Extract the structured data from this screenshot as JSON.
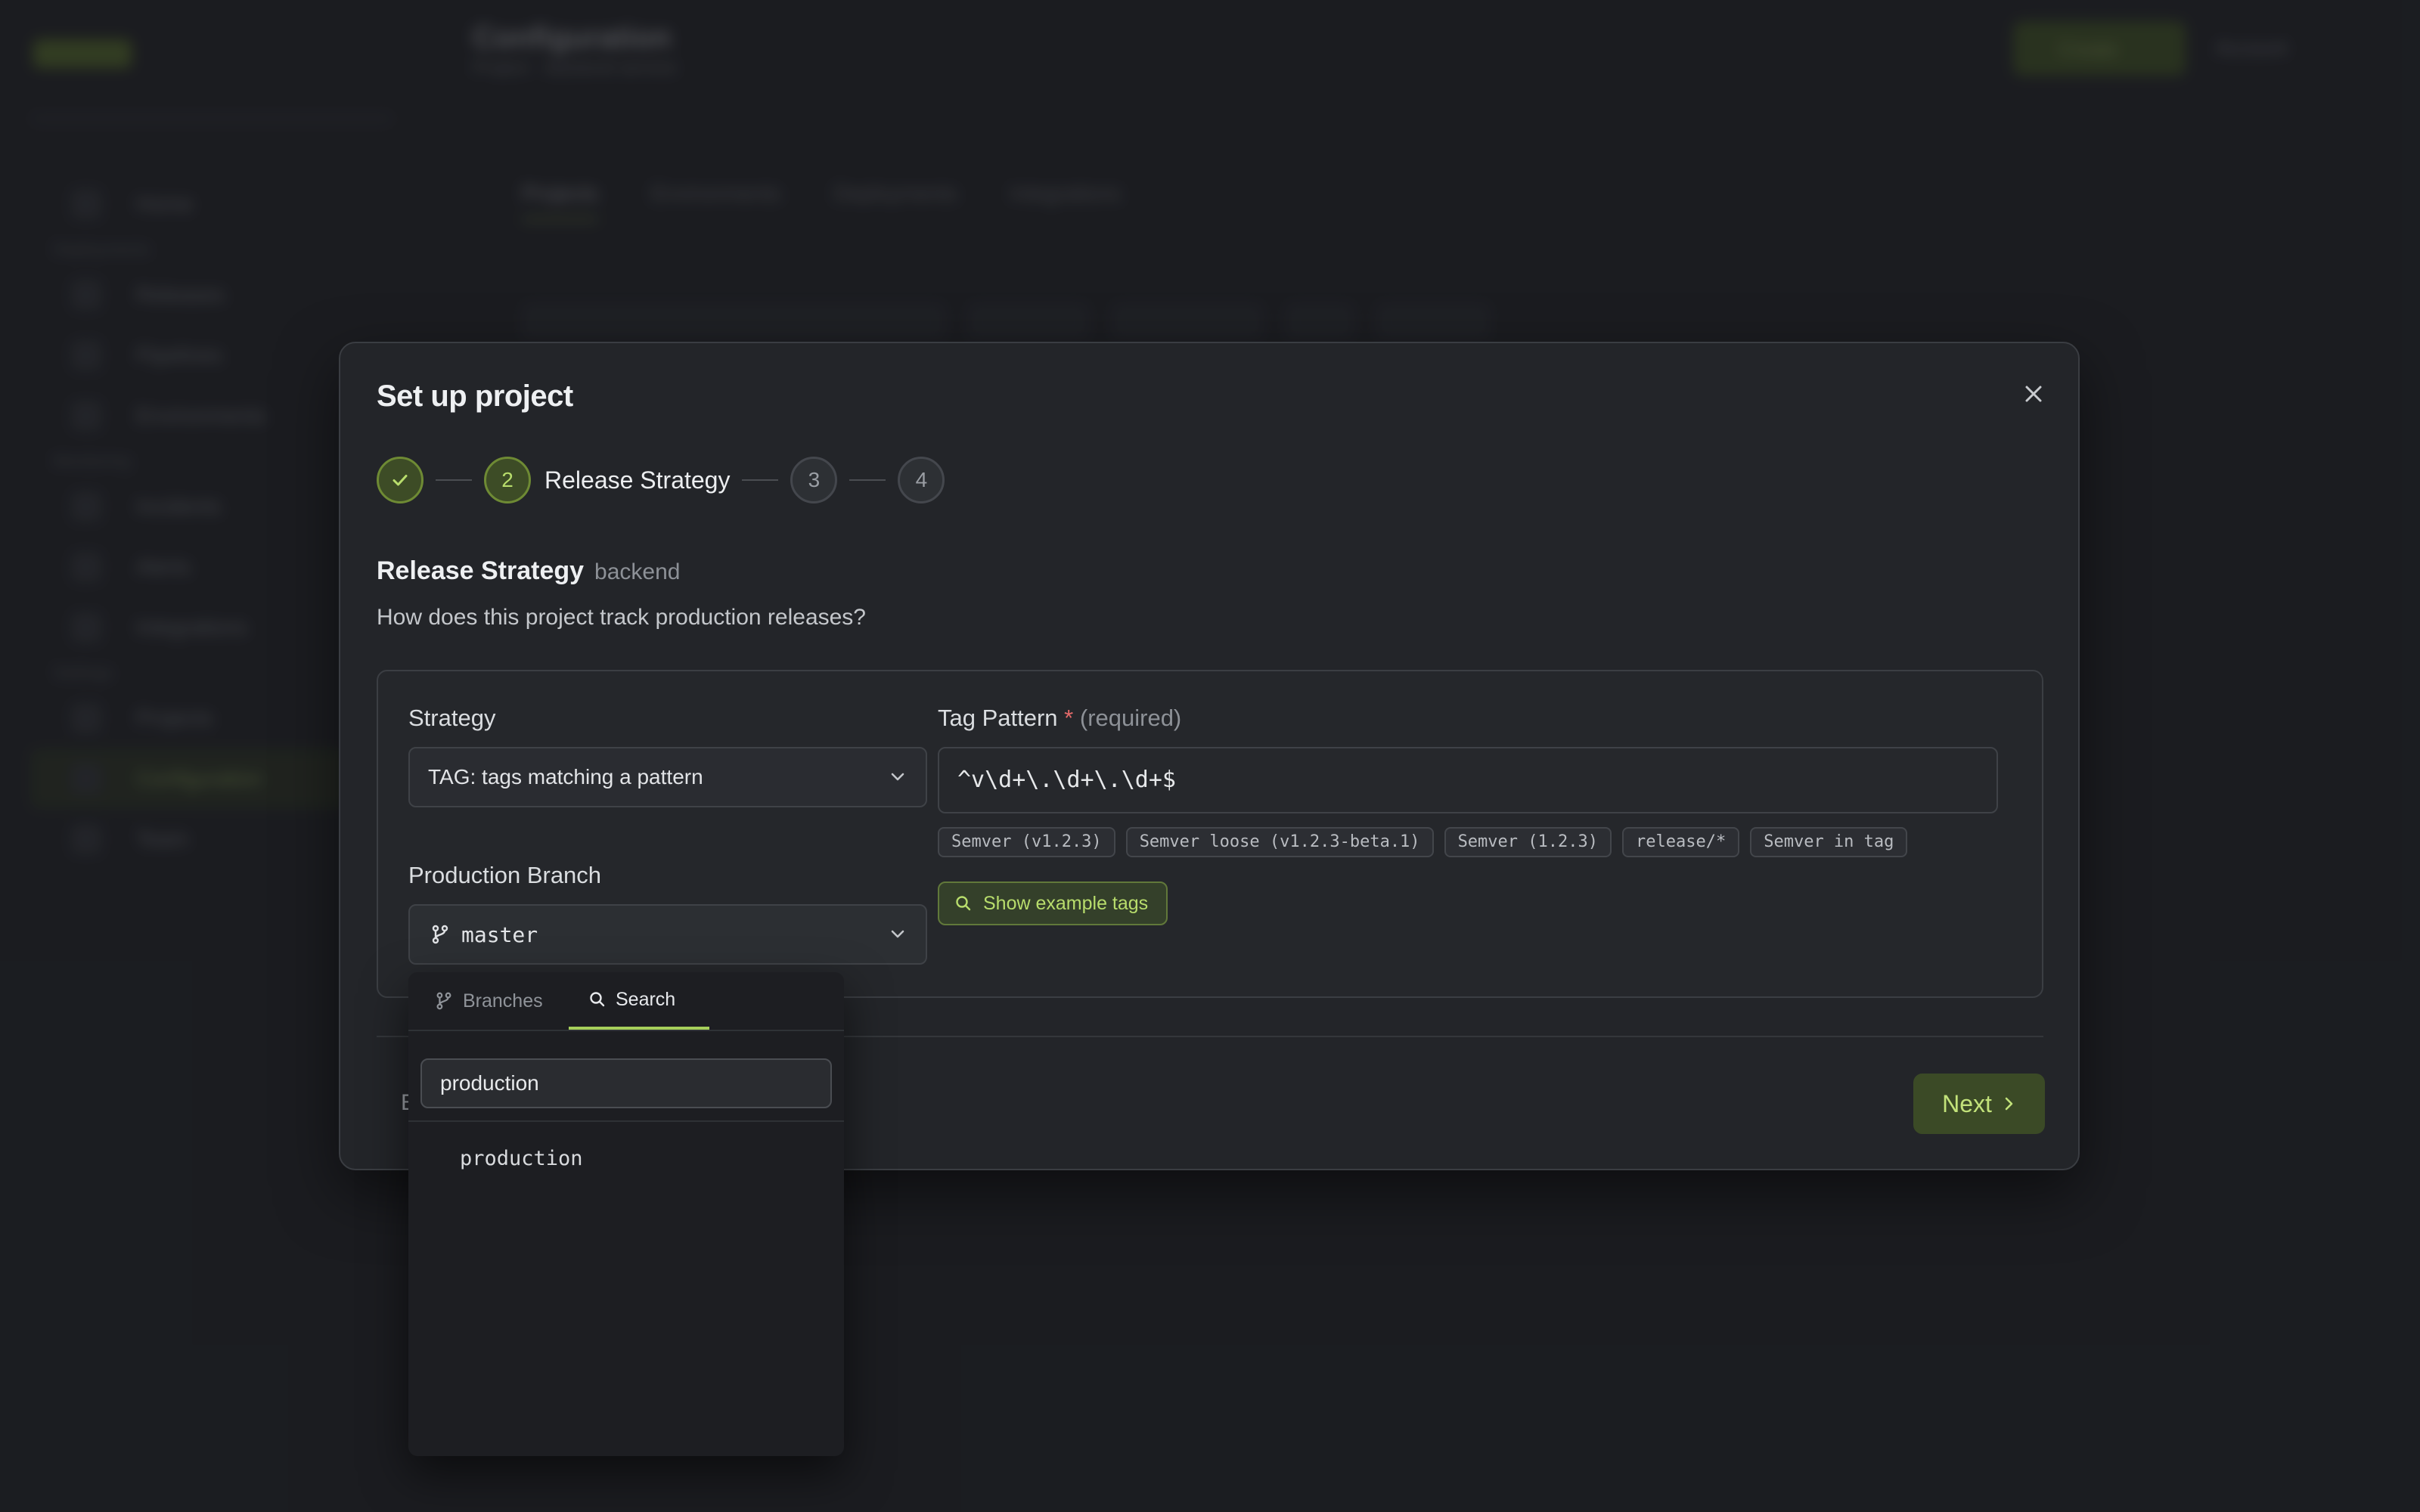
{
  "background": {
    "title": "Configuration",
    "subtitle": "Project · backend service",
    "cta_label": "Create",
    "user_label": "Account",
    "nav": [
      {
        "label": "Home",
        "section": ""
      },
      {
        "label": "Releases",
        "section": "Deployments"
      },
      {
        "label": "Pipelines",
        "section": ""
      },
      {
        "label": "Environments",
        "section": ""
      },
      {
        "label": "Incidents",
        "section": "Monitoring"
      },
      {
        "label": "Alerts",
        "section": ""
      },
      {
        "label": "Integrations",
        "section": ""
      },
      {
        "label": "Projects",
        "section": "Settings"
      },
      {
        "label": "Configuration",
        "section": ""
      },
      {
        "label": "Team",
        "section": ""
      }
    ],
    "tabs": [
      "Projects",
      "Environments",
      "Deployments",
      "Integrations"
    ]
  },
  "modal": {
    "title": "Set up project",
    "close_icon": "close-icon",
    "steps": [
      {
        "number": "1",
        "state": "done",
        "label": ""
      },
      {
        "number": "2",
        "state": "current",
        "label": "Release Strategy"
      },
      {
        "number": "3",
        "state": "todo",
        "label": ""
      },
      {
        "number": "4",
        "state": "todo",
        "label": ""
      }
    ],
    "section_title": "Release Strategy",
    "section_tag": "backend",
    "section_description": "How does this project track production releases?",
    "strategy": {
      "label": "Strategy",
      "value": "TAG: tags matching a pattern"
    },
    "production_branch": {
      "label": "Production Branch",
      "value": "master"
    },
    "tag_pattern": {
      "label": "Tag Pattern",
      "required_star": "*",
      "required_note": "(required)",
      "value": "^v\\d+\\.\\d+\\.\\d+$",
      "presets": [
        "Semver (v1.2.3)",
        "Semver loose (v1.2.3-beta.1)",
        "Semver (1.2.3)",
        "release/*",
        "Semver in tag"
      ],
      "example_button": "Show example tags"
    },
    "back_label": "B",
    "next_label": "Next"
  },
  "branch_popover": {
    "tabs": [
      {
        "label": "Branches",
        "icon": "git-branch-icon"
      },
      {
        "label": "Search",
        "icon": "search-icon",
        "active": true
      }
    ],
    "search_value": "production",
    "results": [
      "production"
    ]
  },
  "colors": {
    "accent": "#b8dd6c",
    "accent_bg": "#3b4a26",
    "modal_bg": "#232529",
    "page_bg": "#202226",
    "required": "#e46a6a"
  }
}
